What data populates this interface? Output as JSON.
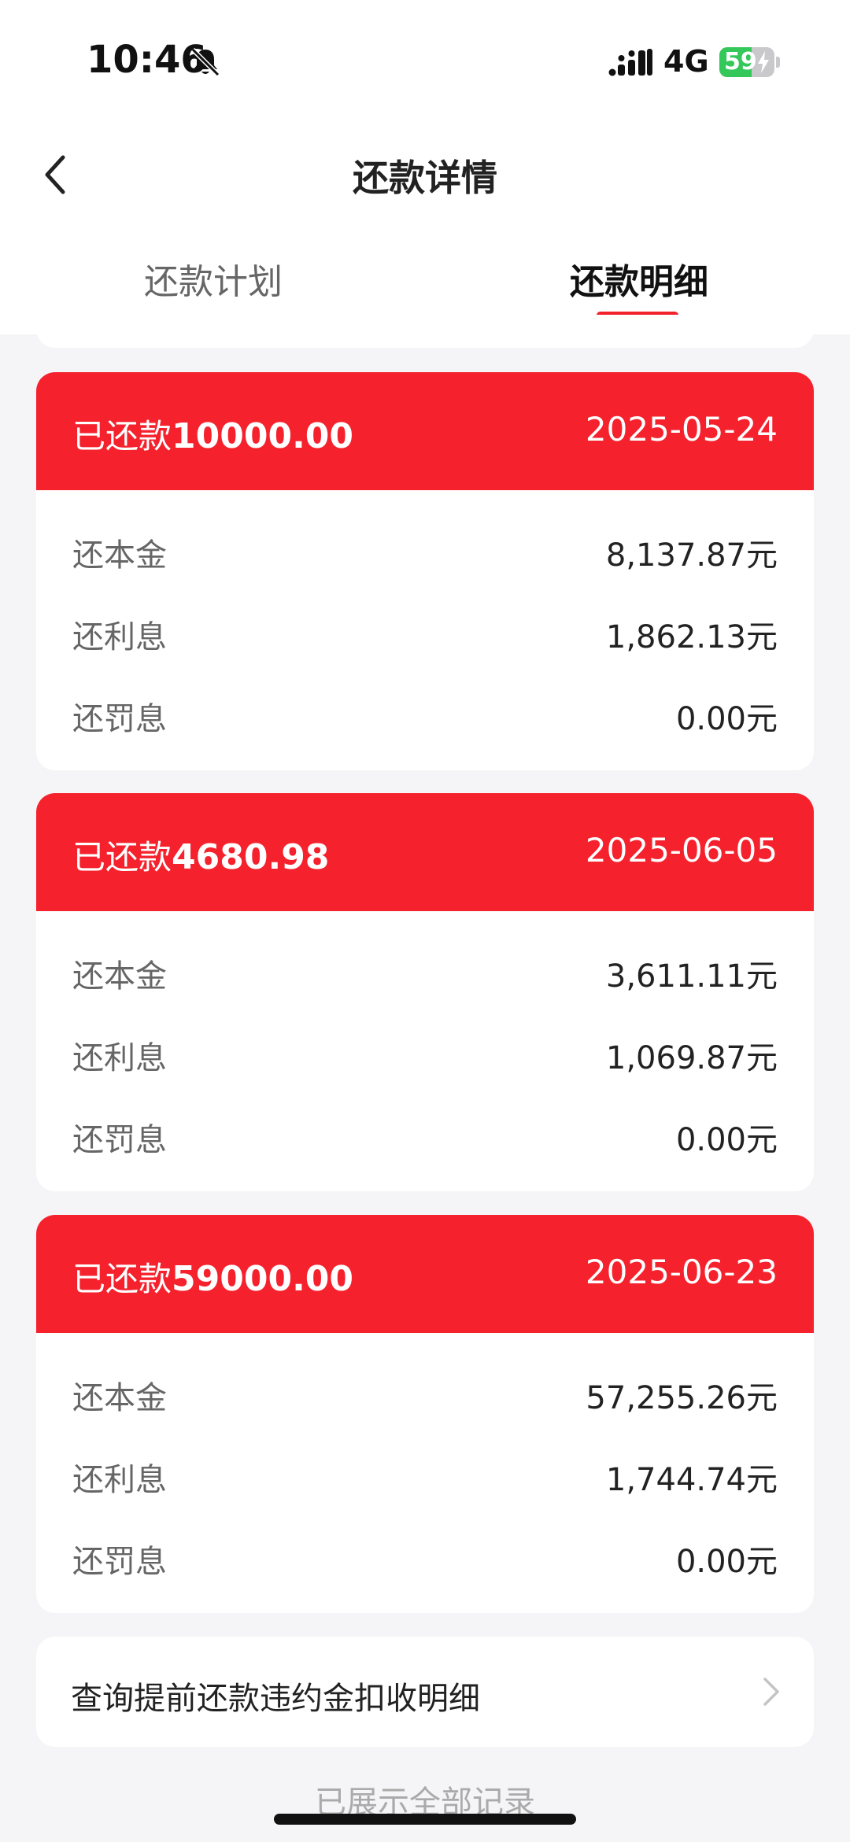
{
  "status_bar": {
    "time": "10:46",
    "network": "4G",
    "battery_percent": "59",
    "battery_level": 0.59
  },
  "nav": {
    "title": "还款详情"
  },
  "tabs": [
    {
      "label": "还款计划",
      "active": false
    },
    {
      "label": "还款明细",
      "active": true
    }
  ],
  "labels": {
    "paid_prefix": "已还款",
    "principal": "还本金",
    "interest": "还利息",
    "penalty": "还罚息"
  },
  "records": [
    {
      "amount": "10000.00",
      "date": "2025-05-24",
      "principal": "8,137.87元",
      "interest": "1,862.13元",
      "penalty": "0.00元"
    },
    {
      "amount": "4680.98",
      "date": "2025-06-05",
      "principal": "3,611.11元",
      "interest": "1,069.87元",
      "penalty": "0.00元"
    },
    {
      "amount": "59000.00",
      "date": "2025-06-23",
      "principal": "57,255.26元",
      "interest": "1,744.74元",
      "penalty": "0.00元"
    }
  ],
  "link": {
    "label": "查询提前还款违约金扣收明细"
  },
  "footer": {
    "note": "已展示全部记录"
  },
  "colors": {
    "accent": "#f5222d",
    "background": "#f5f5f7",
    "battery_green": "#34c759"
  }
}
